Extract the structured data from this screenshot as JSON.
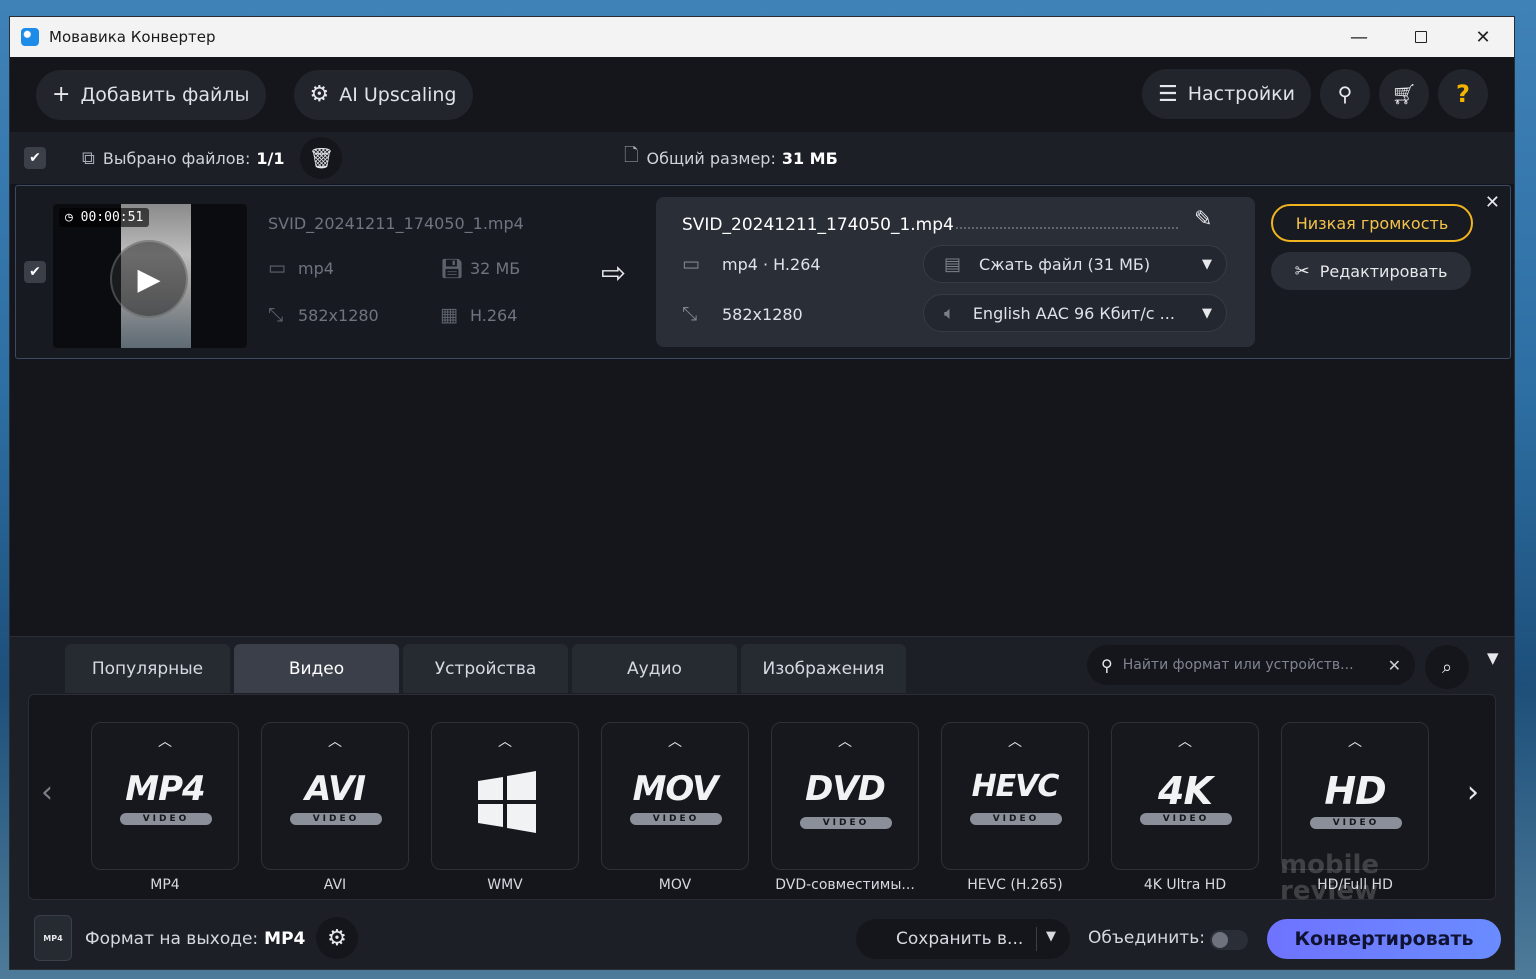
{
  "window": {
    "title": "Мовавика Конвертер"
  },
  "toolbar": {
    "add_files": "Добавить файлы",
    "ai_upscaling": "AI Upscaling",
    "settings": "Настройки"
  },
  "selection": {
    "selected_label": "Выбрано файлов:",
    "selected_value": "1/1",
    "total_size_label": "Общий размер:",
    "total_size_value": "31 МБ"
  },
  "file": {
    "duration": "00:00:51",
    "source": {
      "name": "SVID_20241211_174050_1.mp4",
      "format": "mp4",
      "size": "32 МБ",
      "resolution": "582x1280",
      "codec": "H.264"
    },
    "target": {
      "name": "SVID_20241211_174050_1.mp4",
      "format_codec": "mp4 · H.264",
      "resolution": "582x1280",
      "compress": "Сжать файл (31 МБ)",
      "audio": "English AAC 96 Кбит/с ..."
    },
    "warning_button": "Низкая громкость",
    "edit_button": "Редактировать"
  },
  "format_panel": {
    "tabs": [
      {
        "label": "Популярные",
        "active": false
      },
      {
        "label": "Видео",
        "active": true
      },
      {
        "label": "Устройства",
        "active": false
      },
      {
        "label": "Аудио",
        "active": false
      },
      {
        "label": "Изображения",
        "active": false
      }
    ],
    "search_placeholder": "Найти формат или устройств...",
    "cards": [
      {
        "logo": "MP4",
        "label": "MP4"
      },
      {
        "logo": "AVI",
        "label": "AVI"
      },
      {
        "logo": "",
        "label": "WMV"
      },
      {
        "logo": "MOV",
        "label": "MOV"
      },
      {
        "logo": "DVD",
        "label": "DVD-совместимы..."
      },
      {
        "logo": "HEVC",
        "label": "HEVC (H.265)"
      },
      {
        "logo": "4K",
        "label": "4K Ultra HD"
      },
      {
        "logo": "HD",
        "label": "HD/Full HD"
      }
    ],
    "badge_video": "VIDEO"
  },
  "bottom": {
    "output_icon": "MP4",
    "output_label": "Формат на выходе:",
    "output_value": "MP4",
    "save_to": "Сохранить в...",
    "merge_label": "Объединить:",
    "merge_on": false,
    "convert": "Конвертировать"
  },
  "watermark": {
    "line1": "mobile",
    "line2": "review"
  },
  "colors": {
    "accent": "#6f73ff",
    "warning": "#f0b41e"
  }
}
